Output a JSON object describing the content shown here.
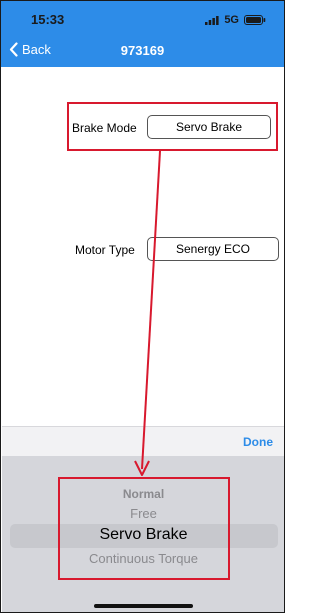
{
  "status_bar": {
    "time": "15:33",
    "network": "5G",
    "icons": [
      "signal-bars-icon",
      "battery-icon"
    ]
  },
  "nav": {
    "back_label": "Back",
    "title": "973169"
  },
  "form": {
    "brake_mode": {
      "label": "Brake Mode",
      "value": "Servo Brake"
    },
    "motor_type": {
      "label": "Motor Type",
      "value": "Senergy ECO"
    }
  },
  "picker": {
    "done_label": "Done",
    "options": [
      "Normal",
      "Free",
      "Servo Brake",
      "Continuous Torque"
    ],
    "selected": "Servo Brake"
  },
  "colors": {
    "header": "#2d8ce8",
    "annotation": "#d8192e",
    "picker_bg": "#d5d6db"
  }
}
